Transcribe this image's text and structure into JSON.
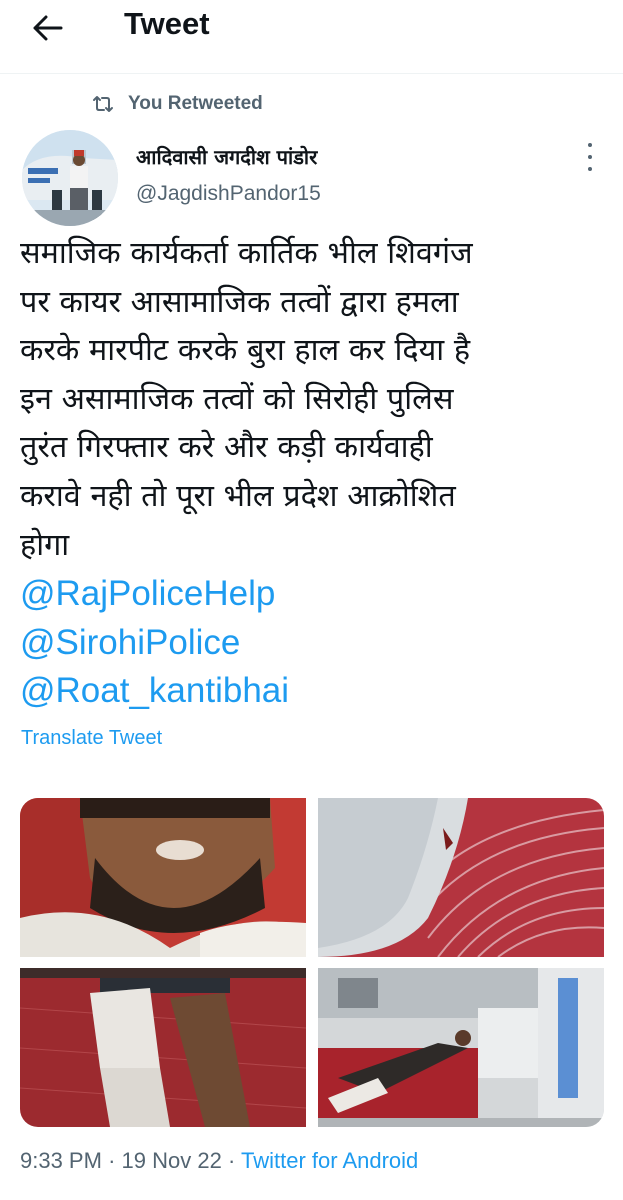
{
  "header": {
    "title": "Tweet",
    "back_icon": "arrow-left-icon"
  },
  "retweet_banner": {
    "label": "You Retweeted",
    "icon": "retweet-icon"
  },
  "author": {
    "display_name": "आदिवासी जगदीश पांडोर",
    "handle": "@JagdishPandor15",
    "avatar_icon": "avatar-image"
  },
  "tweet": {
    "lines": [
      "समाजिक कार्यकर्ता कार्तिक भील शिवगंज",
      "पर कायर आसामाजिक तत्वों द्वारा हमला",
      "करके मारपीट करके बुरा हाल कर दिया है",
      "इन असामाजिक तत्वों को सिरोही पुलिस",
      "तुरंत गिरफ्तार करे और कड़ी कार्यवाही",
      "करावे नही तो पूरा भील प्रदेश आक्रोशित",
      "होगा"
    ],
    "mentions": [
      "@RajPoliceHelp",
      "@SirohiPolice",
      "@Roat_kantibhai"
    ],
    "translate_label": "Translate Tweet"
  },
  "media": [
    "injured-face-photo",
    "leg-wound-photo",
    "bandaged-leg-photo",
    "hospital-bed-photo"
  ],
  "footer": {
    "time": "9:33 PM",
    "date": "19 Nov 22",
    "separator": "·",
    "source": "Twitter for Android"
  },
  "colors": {
    "accent": "#1d9bf0",
    "secondary_text": "#536471",
    "primary_text": "#0f1419"
  }
}
